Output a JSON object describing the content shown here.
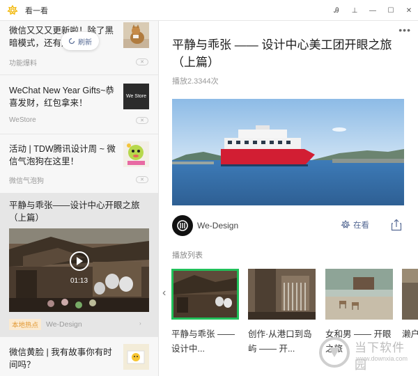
{
  "window": {
    "title": "看一看",
    "controls": [
      "Ꭿ",
      "⊥",
      "—",
      "☐",
      "✕"
    ]
  },
  "feed": {
    "refresh_label": "刷新",
    "items": [
      {
        "title": "微信又又又更新啦！除了黑暗模式，还有这些",
        "source": "功能爆料"
      },
      {
        "title": "WeChat New Year Gifts~恭喜发财，红包拿来！",
        "source": "WeStore",
        "thumb_text": "We Store"
      },
      {
        "title": "活动 | TDW腾讯设计周 ~ 微信气泡狗在这里！",
        "source": "微信气泡狗"
      },
      {
        "title": "平静与乖张——设计中心开眼之旅（上篇）",
        "duration": "01:13",
        "tag": "本地热点",
        "source": "We-Design"
      },
      {
        "title": "微信黄脸 | 我有故事你有时间吗？"
      }
    ]
  },
  "article": {
    "title": "平静与乖张 —— 设计中心美工团开眼之旅（上篇）",
    "plays": "播放2.3344次",
    "author": "We-Design",
    "zaikan": "在看",
    "playlist_label": "播放列表",
    "playlist": [
      {
        "title": "平静与乖张 —— 设计中..."
      },
      {
        "title": "创作·从港口到岛屿 —— 开..."
      },
      {
        "title": "女和男 —— 开眼之旅"
      },
      {
        "title": "濑户..."
      }
    ]
  },
  "watermark": {
    "text": "当下软件园",
    "url": "www.downxia.com"
  },
  "colors": {
    "accent": "#576b95",
    "active_border": "#21c05a",
    "tag_bg": "#fbead0",
    "tag_fg": "#e29a36"
  }
}
